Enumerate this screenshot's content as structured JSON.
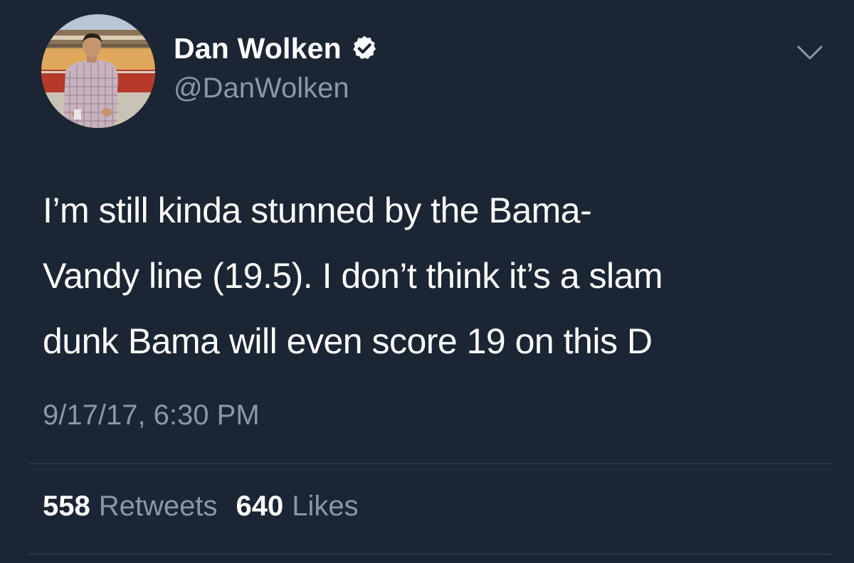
{
  "tweet": {
    "author": {
      "display_name": "Dan Wolken",
      "handle": "@DanWolken",
      "verified": true
    },
    "text_lines": [
      "I’m still kinda stunned by the Bama-",
      "Vandy line (19.5). I don’t think it’s a slam",
      "dunk Bama will even score 19 on this D"
    ],
    "timestamp": "9/17/17, 6:30 PM",
    "stats": {
      "retweets_count": "558",
      "retweets_label": "Retweets",
      "likes_count": "640",
      "likes_label": "Likes"
    }
  },
  "colors": {
    "background": "#1b2533",
    "text_primary": "#ffffff",
    "text_secondary": "#8899a6",
    "divider": "#3a4654",
    "verified_badge": "#ffffff"
  },
  "icons": {
    "verified": "verified-badge-icon",
    "menu": "chevron-down-icon"
  }
}
